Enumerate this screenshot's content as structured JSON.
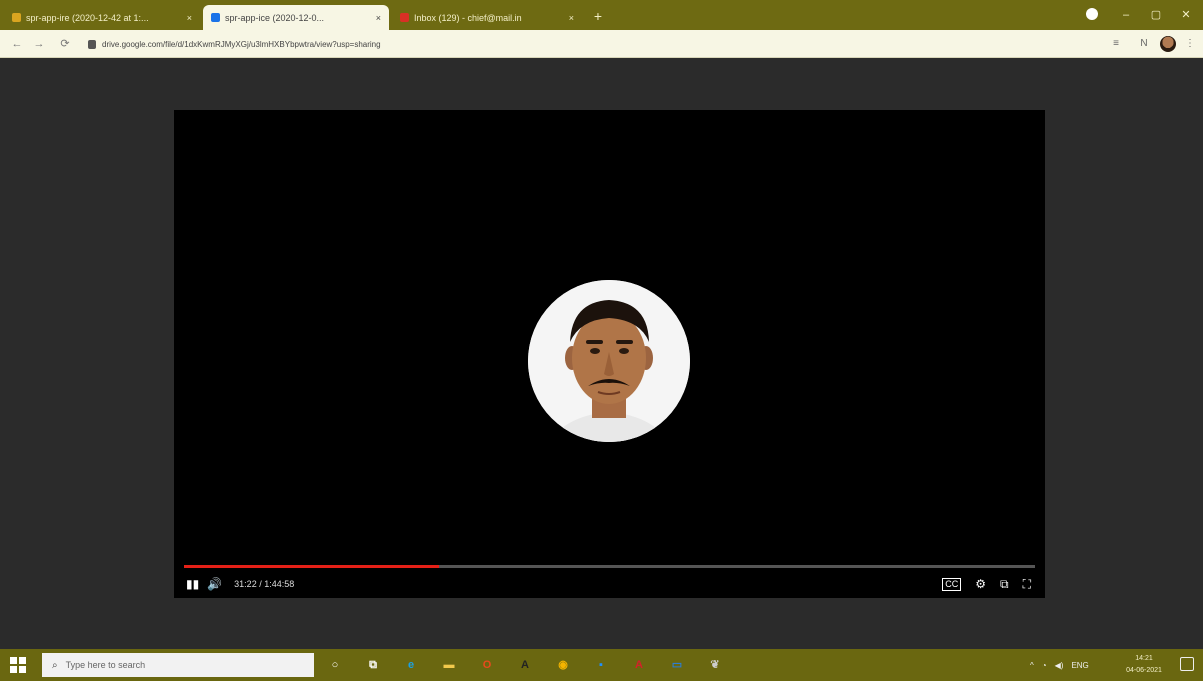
{
  "browser": {
    "tabs": [
      {
        "title": "spr-app-ire (2020-12-42 at 1:...",
        "close": "×",
        "favicon_color": "#d9a520"
      },
      {
        "title": "spr-app-ice (2020-12-0...",
        "close": "×",
        "favicon_color": "#1a73e8"
      },
      {
        "title": "Inbox (129) - chief@mail.in",
        "close": "×",
        "favicon_color": "#d93025"
      }
    ],
    "new_tab": "+",
    "window_controls": {
      "minimize": "–",
      "maximize": "▢",
      "close": "✕"
    },
    "nav": {
      "back": "←",
      "forward": "→",
      "reload": "⟳"
    },
    "url": "drive.google.com/file/d/1dxKwmRJMyXGj/u3lmHXBYbpwtra/view?usp=sharing"
  },
  "player": {
    "progress": 0.3,
    "time": "31:22 / 1:44:58",
    "buttons": {
      "play_pause": "▮▮",
      "volume": "🔊",
      "captions": "CC",
      "settings": "⚙",
      "miniplayer": "⧉",
      "fullscreen": "⛶"
    }
  },
  "taskbar": {
    "search_placeholder": "Type here to search",
    "apps": [
      {
        "icon": "cortana-icon",
        "glyph": "○",
        "color": "#ffffff"
      },
      {
        "icon": "task-view-icon",
        "glyph": "⧉",
        "color": "#ffffff"
      },
      {
        "icon": "edge-icon",
        "glyph": "e",
        "color": "#1ba1e2"
      },
      {
        "icon": "file-explorer-icon",
        "glyph": "▬",
        "color": "#f2c94c"
      },
      {
        "icon": "office-icon",
        "glyph": "O",
        "color": "#e8491d"
      },
      {
        "icon": "app-a-icon",
        "glyph": "A",
        "color": "#222222"
      },
      {
        "icon": "chrome-icon",
        "glyph": "◉",
        "color": "#f4b400"
      },
      {
        "icon": "app-blue-icon",
        "glyph": "▪",
        "color": "#1e90ff"
      },
      {
        "icon": "acrobat-icon",
        "glyph": "A",
        "color": "#d4202a"
      },
      {
        "icon": "app-window-icon",
        "glyph": "▭",
        "color": "#2d7dd2"
      },
      {
        "icon": "app-leaf-icon",
        "glyph": "❦",
        "color": "#cccccc"
      }
    ],
    "tray_lang": "ENG",
    "clock_time": "14:21",
    "clock_date": "04-06-2021"
  }
}
